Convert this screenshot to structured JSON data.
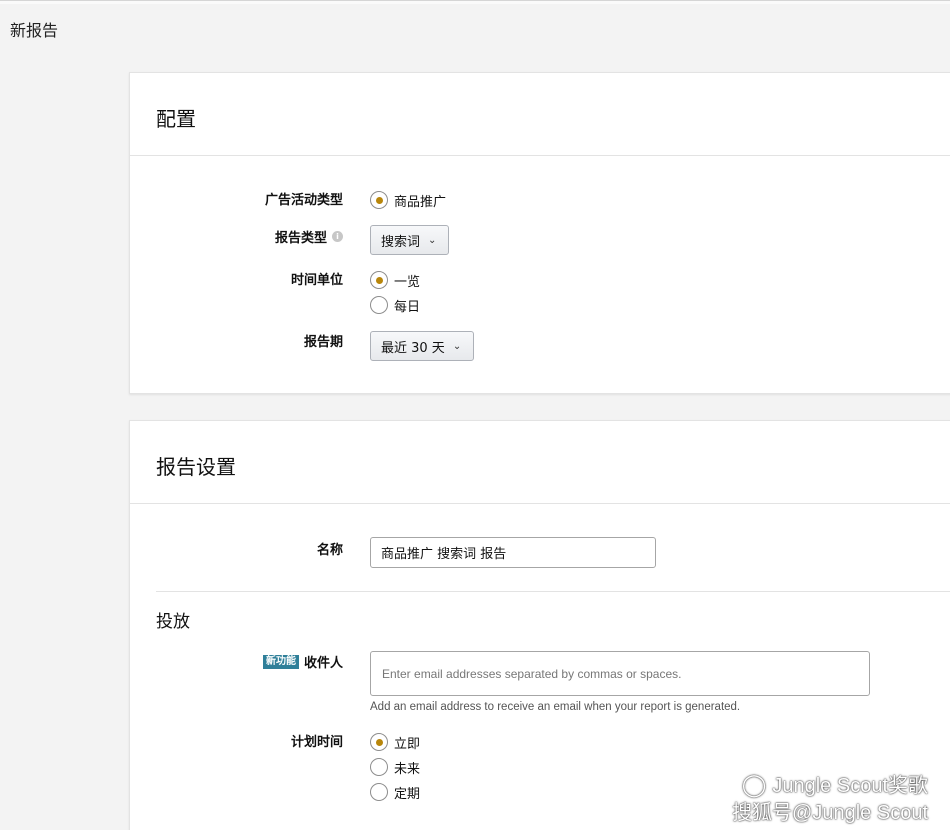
{
  "page": {
    "title": "新报告"
  },
  "config": {
    "title": "配置",
    "campaign_type": {
      "label": "广告活动类型",
      "options": [
        {
          "label": "商品推广",
          "checked": true
        }
      ]
    },
    "report_type": {
      "label": "报告类型",
      "info_icon": "info-icon",
      "selected": "搜索词"
    },
    "time_unit": {
      "label": "时间单位",
      "options": [
        {
          "label": "一览",
          "checked": true
        },
        {
          "label": "每日",
          "checked": false
        }
      ]
    },
    "report_period": {
      "label": "报告期",
      "selected": "最近 30 天"
    }
  },
  "settings": {
    "title": "报告设置",
    "name": {
      "label": "名称",
      "value": "商品推广 搜索词 报告"
    },
    "delivery": {
      "title": "投放",
      "recipients": {
        "badge": "新功能",
        "label": "收件人",
        "placeholder": "Enter email addresses separated by commas or spaces.",
        "hint": "Add an email address to receive an email when your report is generated."
      },
      "schedule": {
        "label": "计划时间",
        "options": [
          {
            "label": "立即",
            "checked": true
          },
          {
            "label": "未来",
            "checked": false
          },
          {
            "label": "定期",
            "checked": false
          }
        ]
      }
    }
  },
  "watermark": {
    "line1": "Jungle Scout奖歌",
    "line2": "搜狐号@Jungle Scout",
    "icon": "wechat-logo-icon"
  },
  "colors": {
    "radio_checked": "#b8860b",
    "badge": "#2f7f99",
    "background": "#f3f3f3"
  }
}
